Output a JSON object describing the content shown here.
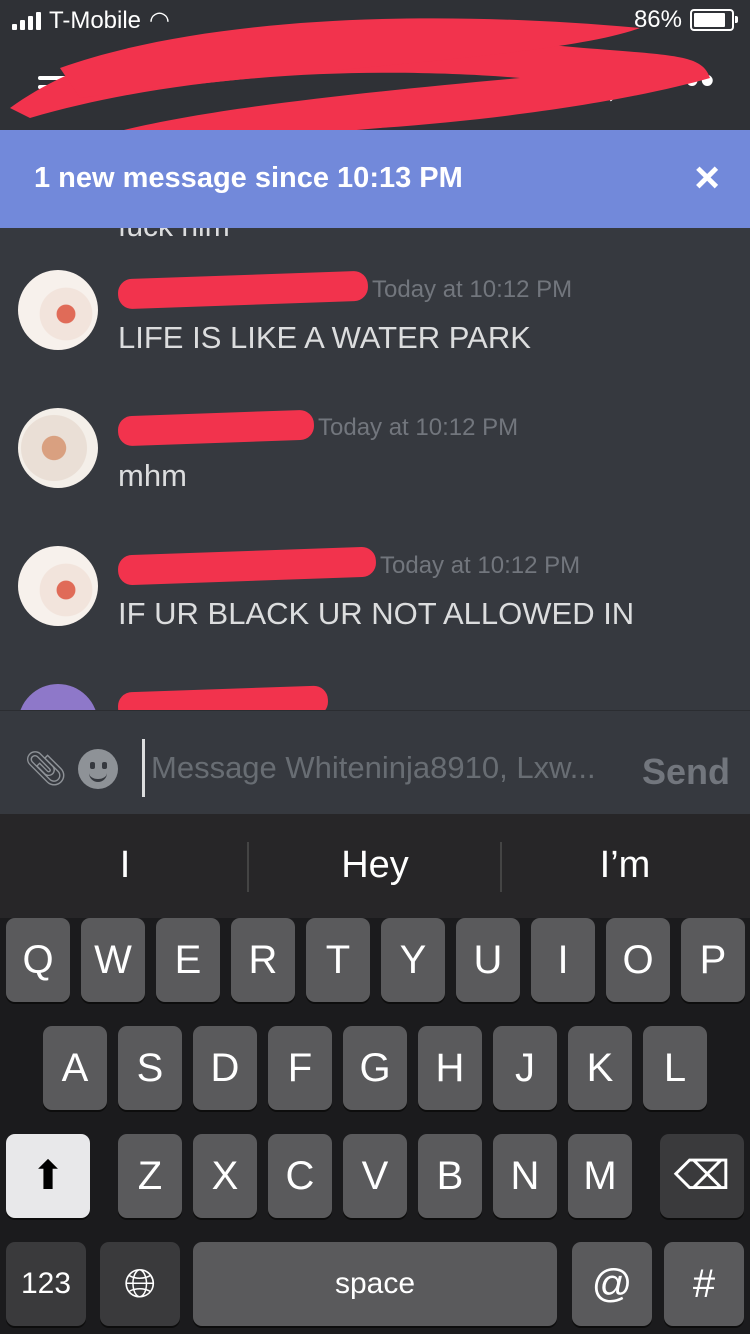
{
  "status_bar": {
    "carrier": "T-Mobile",
    "battery": "86%",
    "battery_level": 0.86
  },
  "banner": {
    "text": "1 new message since 10:13 PM",
    "close": "×"
  },
  "messages": [
    {
      "partial_text": "fuck him"
    },
    {
      "timestamp": "Today at 10:12 PM",
      "body": "LIFE IS LIKE A WATER PARK"
    },
    {
      "timestamp": "Today at 10:12 PM",
      "body": "mhm"
    },
    {
      "timestamp": "Today at 10:12 PM",
      "body": "IF UR  BLACK UR NOT ALLOWED IN"
    }
  ],
  "composer": {
    "placeholder": "Message Whiteninja8910, Lxw...",
    "send_label": "Send"
  },
  "keyboard": {
    "suggestions": [
      "I",
      "Hey",
      "I’m"
    ],
    "row1": [
      "Q",
      "W",
      "E",
      "R",
      "T",
      "Y",
      "U",
      "I",
      "O",
      "P"
    ],
    "row2": [
      "A",
      "S",
      "D",
      "F",
      "G",
      "H",
      "J",
      "K",
      "L"
    ],
    "row3": [
      "Z",
      "X",
      "C",
      "V",
      "B",
      "N",
      "M"
    ],
    "numbers_label": "123",
    "space_label": "space",
    "at_label": "@",
    "hash_label": "#"
  }
}
